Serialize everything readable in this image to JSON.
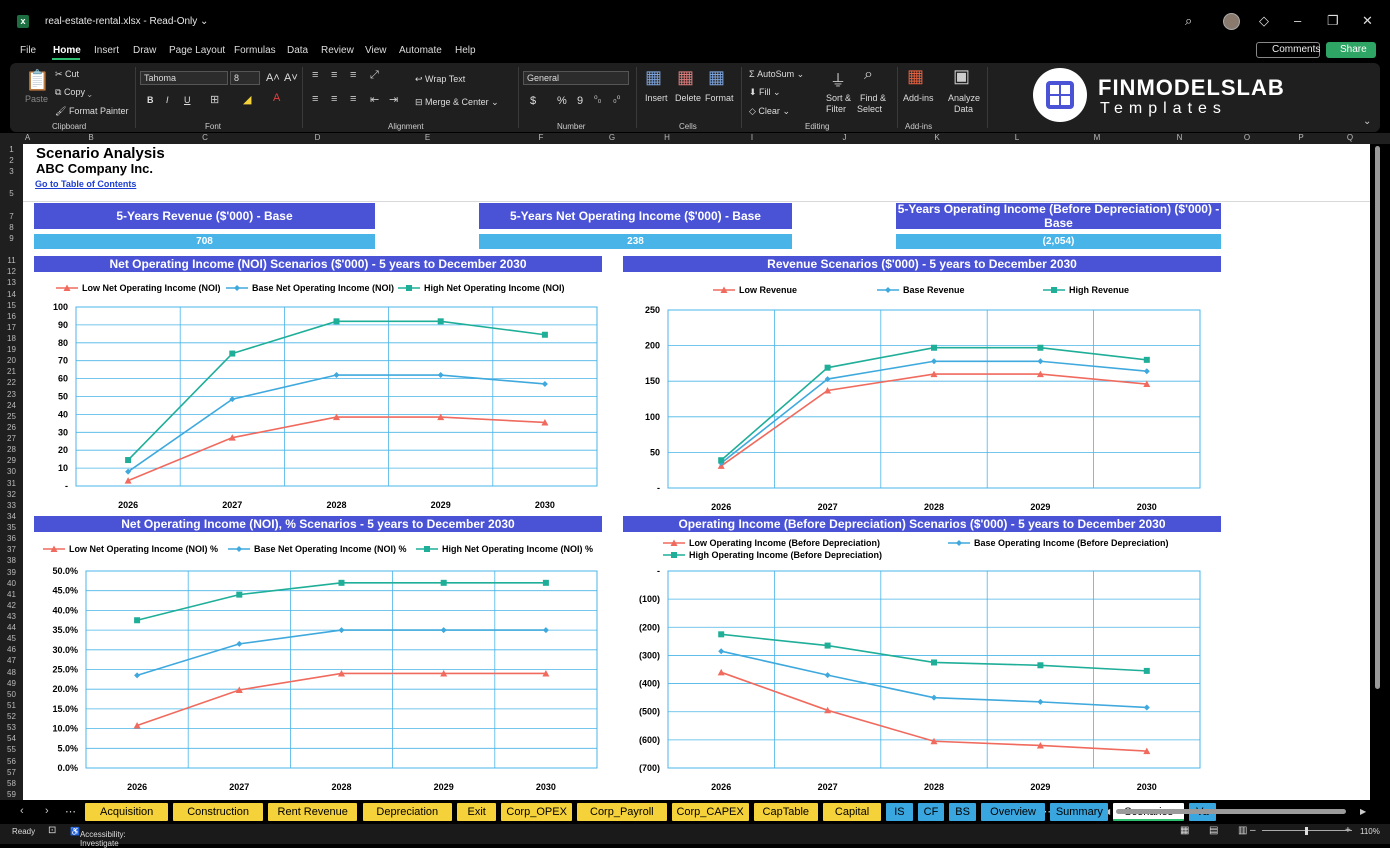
{
  "window": {
    "title": "real-estate-rental.xlsx  -  Read-Only ⌄"
  },
  "menu": {
    "items": [
      "File",
      "Home",
      "Insert",
      "Draw",
      "Page Layout",
      "Formulas",
      "Data",
      "Review",
      "View",
      "Automate",
      "Help"
    ],
    "comments": "Comments",
    "share": "Share"
  },
  "ribbon": {
    "clipboard": {
      "paste": "Paste",
      "cut": "Cut",
      "copy": "Copy",
      "format_painter": "Format Painter",
      "label": "Clipboard"
    },
    "font": {
      "name": "Tahoma",
      "size": "8",
      "label": "Font",
      "bold": "B",
      "italic": "I",
      "underline": "U"
    },
    "alignment": {
      "wrap": "Wrap Text",
      "merge": "Merge & Center",
      "label": "Alignment"
    },
    "number": {
      "format": "General",
      "label": "Number",
      "currency": "$",
      "percent": "%",
      "comma": "9"
    },
    "cells": {
      "insert": "Insert",
      "delete": "Delete",
      "format": "Format",
      "label": "Cells"
    },
    "editing": {
      "autosum": "AutoSum",
      "fill": "Fill",
      "clear": "Clear",
      "sort1": "Sort &",
      "sort2": "Filter",
      "find1": "Find &",
      "find2": "Select",
      "label": "Editing"
    },
    "addins": {
      "addins": "Add-ins",
      "label": "Add-ins",
      "analyze1": "Analyze",
      "analyze2": "Data"
    },
    "brand": {
      "name": "FINMODELSLAB",
      "sub": "Templates"
    }
  },
  "columns": [
    "A",
    "B",
    "C",
    "D",
    "E",
    "F",
    "G",
    "H",
    "I",
    "J",
    "K",
    "L",
    "M",
    "N",
    "O",
    "P",
    "Q"
  ],
  "rows": [
    "1",
    "2",
    "3",
    "",
    "5",
    "",
    "7",
    "8",
    "9",
    "",
    "11",
    "12",
    "13",
    "14",
    "15",
    "16",
    "17",
    "18",
    "19",
    "20",
    "21",
    "22",
    "23",
    "24",
    "25",
    "26",
    "27",
    "28",
    "29",
    "30",
    "31",
    "32",
    "33",
    "34",
    "35",
    "36",
    "37",
    "38",
    "39",
    "40",
    "41",
    "42",
    "43",
    "44",
    "45",
    "46",
    "47",
    "48",
    "49",
    "50",
    "51",
    "52",
    "53",
    "54",
    "55",
    "56",
    "57",
    "58",
    "59"
  ],
  "sheet": {
    "title": "Scenario Analysis",
    "company": "ABC Company Inc.",
    "link": "Go to Table of Contents",
    "kpis": [
      {
        "title": "5-Years Revenue ($'000) - Base",
        "value": "708"
      },
      {
        "title": "5-Years Net Operating Income ($'000) - Base",
        "value": "238"
      },
      {
        "title": "5-Years Operating Income (Before Depreciation) ($'000) - Base",
        "value": "(2,054)"
      }
    ]
  },
  "chart_data": [
    {
      "type": "line",
      "title": "Net Operating Income (NOI) Scenarios ($'000) - 5 years to December 2030",
      "categories": [
        "2026",
        "2027",
        "2028",
        "2029",
        "2030"
      ],
      "series": [
        {
          "name": "Low Net Operating Income (NOI)",
          "values": [
            3,
            27,
            38.5,
            38.5,
            35.5
          ],
          "color": "#f06a5e",
          "marker": "triangle"
        },
        {
          "name": "Base Net Operating Income (NOI)",
          "values": [
            8,
            48.5,
            62,
            62,
            57
          ],
          "color": "#3fa9dd",
          "marker": "diamond"
        },
        {
          "name": "High Net Operating Income (NOI)",
          "values": [
            14.5,
            74,
            92,
            92,
            84.5
          ],
          "color": "#1fae98",
          "marker": "square"
        }
      ],
      "ylim": [
        0,
        100
      ],
      "yticks": [
        "-",
        "10",
        "20",
        "30",
        "40",
        "50",
        "60",
        "70",
        "80",
        "90",
        "100"
      ],
      "grid": true,
      "legend": "top"
    },
    {
      "type": "line",
      "title": "Revenue Scenarios ($'000) - 5 years to December 2030",
      "categories": [
        "2026",
        "2027",
        "2028",
        "2029",
        "2030"
      ],
      "series": [
        {
          "name": "Low Revenue",
          "values": [
            31,
            137,
            160,
            160,
            146
          ],
          "color": "#f06a5e",
          "marker": "triangle"
        },
        {
          "name": "Base Revenue",
          "values": [
            35,
            153,
            178,
            178,
            164
          ],
          "color": "#3fa9dd",
          "marker": "diamond"
        },
        {
          "name": "High Revenue",
          "values": [
            39,
            169,
            197,
            197,
            180
          ],
          "color": "#1fae98",
          "marker": "square"
        }
      ],
      "ylim": [
        0,
        250
      ],
      "yticks": [
        "-",
        "50",
        "100",
        "150",
        "200",
        "250"
      ],
      "grid": true,
      "legend": "top"
    },
    {
      "type": "line",
      "title": "Net Operating Income (NOI), % Scenarios - 5 years to December 2030",
      "categories": [
        "2026",
        "2027",
        "2028",
        "2029",
        "2030"
      ],
      "series": [
        {
          "name": "Low Net Operating Income (NOI) %",
          "values": [
            10.8,
            19.8,
            24,
            24,
            24
          ],
          "color": "#f06a5e",
          "marker": "triangle"
        },
        {
          "name": "Base Net Operating Income (NOI) %",
          "values": [
            23.5,
            31.5,
            35,
            35,
            35
          ],
          "color": "#3fa9dd",
          "marker": "diamond"
        },
        {
          "name": "High Net Operating Income (NOI) %",
          "values": [
            37.5,
            44,
            47,
            47,
            47
          ],
          "color": "#1fae98",
          "marker": "square"
        }
      ],
      "ylim": [
        0,
        50
      ],
      "yticks": [
        "0.0%",
        "5.0%",
        "10.0%",
        "15.0%",
        "20.0%",
        "25.0%",
        "30.0%",
        "35.0%",
        "40.0%",
        "45.0%",
        "50.0%"
      ],
      "grid": true,
      "legend": "top"
    },
    {
      "type": "line",
      "title": "Operating Income (Before Depreciation) Scenarios ($'000) - 5 years to December 2030",
      "categories": [
        "2026",
        "2027",
        "2028",
        "2029",
        "2030"
      ],
      "series": [
        {
          "name": "Low Operating Income (Before Depreciation)",
          "values": [
            -360,
            -495,
            -605,
            -620,
            -640
          ],
          "color": "#f06a5e",
          "marker": "triangle"
        },
        {
          "name": "Base Operating Income (Before Depreciation)",
          "values": [
            -285,
            -370,
            -450,
            -465,
            -485
          ],
          "color": "#3fa9dd",
          "marker": "diamond"
        },
        {
          "name": "High Operating Income (Before Depreciation)",
          "values": [
            -225,
            -265,
            -325,
            -335,
            -355
          ],
          "color": "#1fae98",
          "marker": "square"
        }
      ],
      "ylim": [
        -700,
        0
      ],
      "yticks": [
        "(700)",
        "(600)",
        "(500)",
        "(400)",
        "(300)",
        "(200)",
        "(100)",
        "-"
      ],
      "grid": true,
      "legend": "top"
    }
  ],
  "tabs": [
    {
      "label": "Acquisition",
      "color": "y"
    },
    {
      "label": "Construction",
      "color": "y"
    },
    {
      "label": "Rent Revenue",
      "color": "y"
    },
    {
      "label": "Depreciation",
      "color": "y"
    },
    {
      "label": "Exit",
      "color": "y"
    },
    {
      "label": "Corp_OPEX",
      "color": "y"
    },
    {
      "label": "Corp_Payroll",
      "color": "y"
    },
    {
      "label": "Corp_CAPEX",
      "color": "y"
    },
    {
      "label": "CapTable",
      "color": "y"
    },
    {
      "label": "Capital",
      "color": "y"
    },
    {
      "label": "IS",
      "color": "b"
    },
    {
      "label": "CF",
      "color": "b"
    },
    {
      "label": "BS",
      "color": "b"
    },
    {
      "label": "Overview",
      "color": "b"
    },
    {
      "label": "Summary",
      "color": "b"
    },
    {
      "label": "Scenarios",
      "color": "active"
    },
    {
      "label": "Va",
      "color": "b"
    }
  ],
  "status": {
    "ready": "Ready",
    "accessibility": "Accessibility: Investigate",
    "zoom": "110%"
  }
}
